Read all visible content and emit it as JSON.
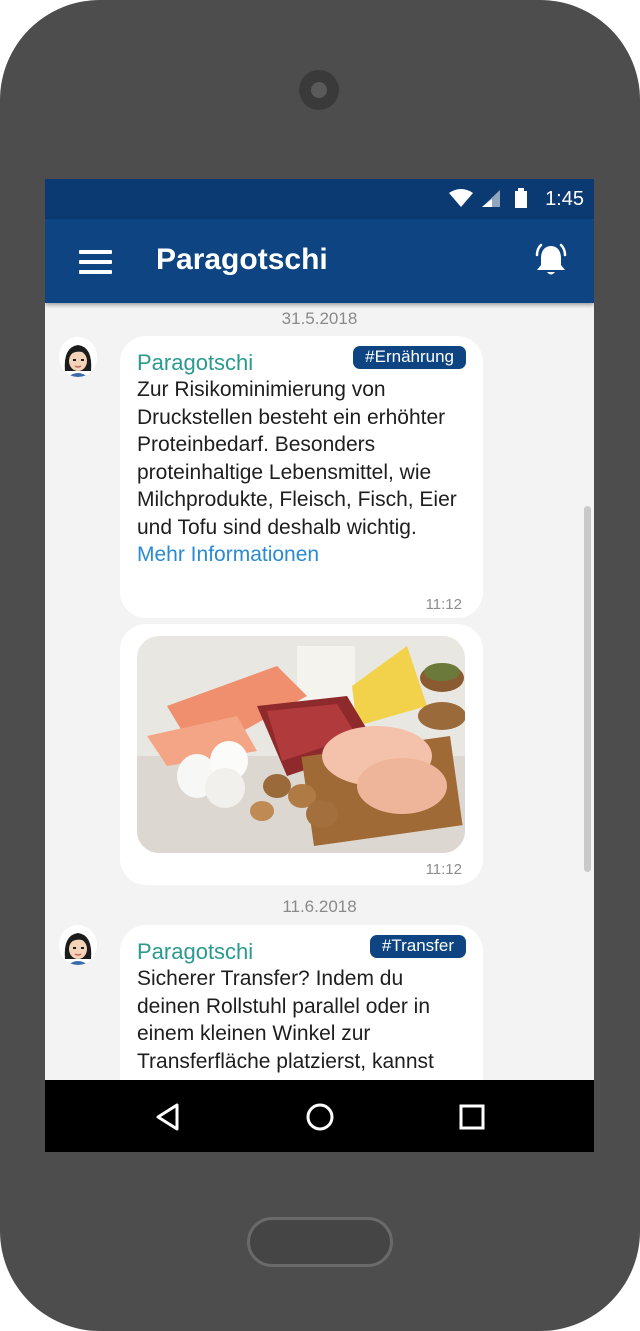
{
  "status_bar": {
    "time": "1:45",
    "icons": [
      "wifi-icon",
      "cell-signal-icon",
      "battery-icon"
    ]
  },
  "app_bar": {
    "title": "Paragotschi",
    "menu_icon": "hamburger-menu-icon",
    "bell_icon": "bell-ringing-icon"
  },
  "colors": {
    "primary": "#0d4481",
    "status_bar": "#0b3a72",
    "sender": "#2a9a8f",
    "link": "#2a8ad4",
    "background": "#f3f3f3"
  },
  "messages": [
    {
      "date": "31.5.2018",
      "sender": "Paragotschi",
      "tag": "#Ernährung",
      "text": "Zur Risikominimierung von Druckstellen besteht ein erhöhter Proteinbedarf. Besonders proteinhaltige Lebensmittel, wie Milchprodukte, Fleisch, Fisch, Eier und Tofu sind deshalb wichtig.",
      "link": "Mehr Informationen",
      "time": "11:12",
      "image_time": "11:12"
    },
    {
      "date": "11.6.2018",
      "sender": "Paragotschi",
      "tag": "#Transfer",
      "text": "Sicherer Transfer? Indem du deinen Rollstuhl parallel oder in einem kleinen Winkel zur Transferfläche platzierst, kannst"
    }
  ],
  "nav_bar": {
    "back_icon": "back-triangle-icon",
    "home_icon": "home-circle-icon",
    "recents_icon": "recents-square-icon"
  }
}
